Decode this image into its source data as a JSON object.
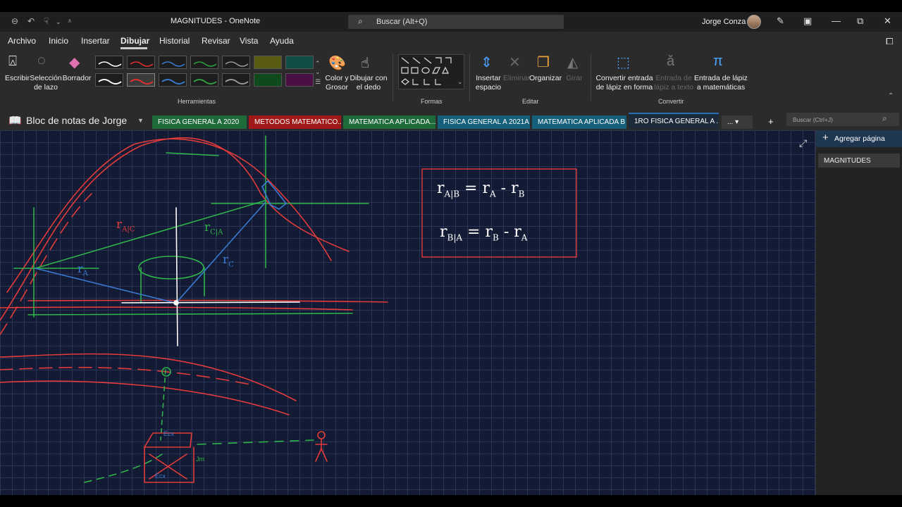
{
  "window": {
    "title": "MAGNITUDES  -  OneNote",
    "search_placeholder": "Buscar (Alt+Q)",
    "user": "Jorge Conza"
  },
  "menu": [
    "Archivo",
    "Inicio",
    "Insertar",
    "Dibujar",
    "Historial",
    "Revisar",
    "Vista",
    "Ayuda"
  ],
  "ribbon": {
    "write": "Escribir",
    "lasso": "Selección de lazo",
    "eraser": "Borrador",
    "group_tools": "Herramientas",
    "color": "Color y Grosor",
    "finger": "Dibujar con el dedo",
    "group_shapes": "Formas",
    "insert_space": "Insertar espacio",
    "delete": "Eliminar",
    "arrange": "Organizar",
    "rotate": "Girar",
    "group_edit": "Editar",
    "ink_to_shape": "Convertir entrada de lápiz en forma",
    "ink_to_text": "Entrada de lápiz a texto",
    "ink_to_math": "Entrada de lápiz a matemáticas",
    "group_convert": "Convertir"
  },
  "notebook": {
    "name": "Bloc de notas de Jorge",
    "tabs": [
      {
        "label": "FISICA GENERAL A 2020",
        "color": "#1e6a3a"
      },
      {
        "label": "METODOS MATEMATICO...",
        "color": "#a01818"
      },
      {
        "label": "MATEMATICA APLICADA...",
        "color": "#1e6a3a"
      },
      {
        "label": "FISICA GENERAL A 2021A",
        "color": "#14607a"
      },
      {
        "label": "MATEMATICA APLICADA B",
        "color": "#14607a"
      },
      {
        "label": "1RO FISICA GENERAL A ...",
        "color": "#1d2a3a"
      }
    ],
    "more": "...",
    "add": "+",
    "search_placeholder": "Buscar (Ctrl+J)"
  },
  "pages": {
    "add_label": "Agregar página",
    "items": [
      "MAGNITUDES"
    ]
  },
  "canvas": {
    "eq1_lhs": "r",
    "eq1_lhs_sub": "A|B",
    "eq1_rhs_a": "r",
    "eq1_rhs_a_sub": "A",
    "eq1_rhs_b": "r",
    "eq1_rhs_b_sub": "B",
    "eq2_lhs": "r",
    "eq2_lhs_sub": "B|A",
    "eq2_rhs_a": "r",
    "eq2_rhs_a_sub": "B",
    "eq2_rhs_b": "r",
    "eq2_rhs_b_sub": "A",
    "label_rac": "r",
    "label_rac_sub": "A|C",
    "label_rca": "r",
    "label_rca_sub": "C|A",
    "label_rc": "r",
    "label_rc_sub": "C",
    "label_ra": "r",
    "label_ra_sub": "A",
    "box_top": "Ecx",
    "box_bottom": "Ecx",
    "box_side": "Jm"
  }
}
